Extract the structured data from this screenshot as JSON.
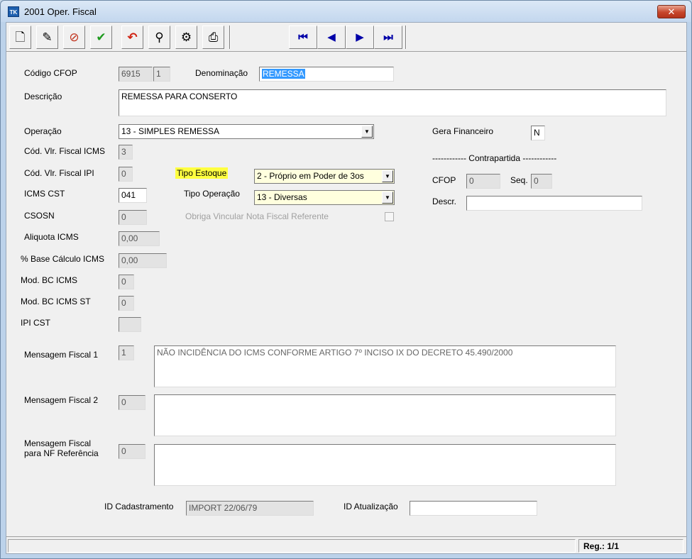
{
  "window": {
    "title": "2001 Oper. Fiscal",
    "app_icon_text": "TK",
    "close_glyph": "✕"
  },
  "toolbar": {
    "buttons": [
      {
        "name": "new-icon",
        "glyph": "🗋"
      },
      {
        "name": "edit-icon",
        "glyph": "✎"
      },
      {
        "name": "cancel-icon",
        "glyph": "⊘"
      },
      {
        "name": "save-icon",
        "glyph": "✔"
      },
      {
        "name": "undo-icon",
        "glyph": "↶"
      },
      {
        "name": "search-icon",
        "glyph": "⚲"
      },
      {
        "name": "tools-icon",
        "glyph": "⚙"
      },
      {
        "name": "print-icon",
        "glyph": "⎙"
      }
    ],
    "nav": {
      "first": "⏮",
      "prev": "◀",
      "next": "▶",
      "last": "⏭"
    }
  },
  "form": {
    "cfop_label": "Código CFOP",
    "cfop_value": "6915",
    "cfop_seq": "1",
    "denominacao_label": "Denominação",
    "denominacao_value": "REMESSA",
    "descricao_label": "Descrição",
    "descricao_value": "REMESSA PARA CONSERTO",
    "operacao_label": "Operação",
    "operacao_value": "13 - SIMPLES REMESSA",
    "gera_financeiro_label": "Gera Financeiro",
    "gera_financeiro_value": "N",
    "cod_icms_label": "Cód. Vlr. Fiscal ICMS",
    "cod_icms_value": "3",
    "cod_ipi_label": "Cód. Vlr. Fiscal IPI",
    "cod_ipi_value": "0",
    "icms_cst_label": "ICMS CST",
    "icms_cst_value": "041",
    "csosn_label": "CSOSN",
    "csosn_value": "0",
    "aliquota_label": "Aliquota ICMS",
    "aliquota_value": "0,00",
    "base_calc_label": "% Base Cálculo ICMS",
    "base_calc_value": "0,00",
    "mod_bc_label": "Mod. BC ICMS",
    "mod_bc_value": "0",
    "mod_bc_st_label": "Mod. BC ICMS ST",
    "mod_bc_st_value": "0",
    "ipi_cst_label": "IPI CST",
    "ipi_cst_value": "",
    "tipo_estoque_label": "Tipo Estoque",
    "tipo_estoque_value": "2 - Próprio em Poder de 3os",
    "tipo_operacao_label": "Tipo Operação",
    "tipo_operacao_value": "13 - Diversas",
    "obriga_vincular_label": "Obriga Vincular Nota Fiscal Referente",
    "contrapartida_label": "------------ Contrapartida ------------",
    "cp_cfop_label": "CFOP",
    "cp_cfop_value": "0",
    "cp_seq_label": "Seq.",
    "cp_seq_value": "0",
    "cp_descr_label": "Descr.",
    "cp_descr_value": "",
    "msg1_label": "Mensagem Fiscal 1",
    "msg1_code": "1",
    "msg1_text": "NÃO INCIDÊNCIA DO ICMS CONFORME ARTIGO 7º INCISO IX DO DECRETO 45.490/2000",
    "msg2_label": "Mensagem Fiscal 2",
    "msg2_code": "0",
    "msg2_text": "",
    "msg3_label_line1": "Mensagem Fiscal",
    "msg3_label_line2": "para NF Referência",
    "msg3_code": "0",
    "msg3_text": "",
    "id_cad_label": "ID Cadastramento",
    "id_cad_value": "IMPORT 22/06/79",
    "id_atual_label": "ID Atualização",
    "id_atual_value": ""
  },
  "status": {
    "left": "",
    "record": "Reg.: 1/1"
  },
  "colors": {
    "highlight": "#ffff40",
    "selection": "#3399ff",
    "nav_arrows": "#0000a8"
  }
}
